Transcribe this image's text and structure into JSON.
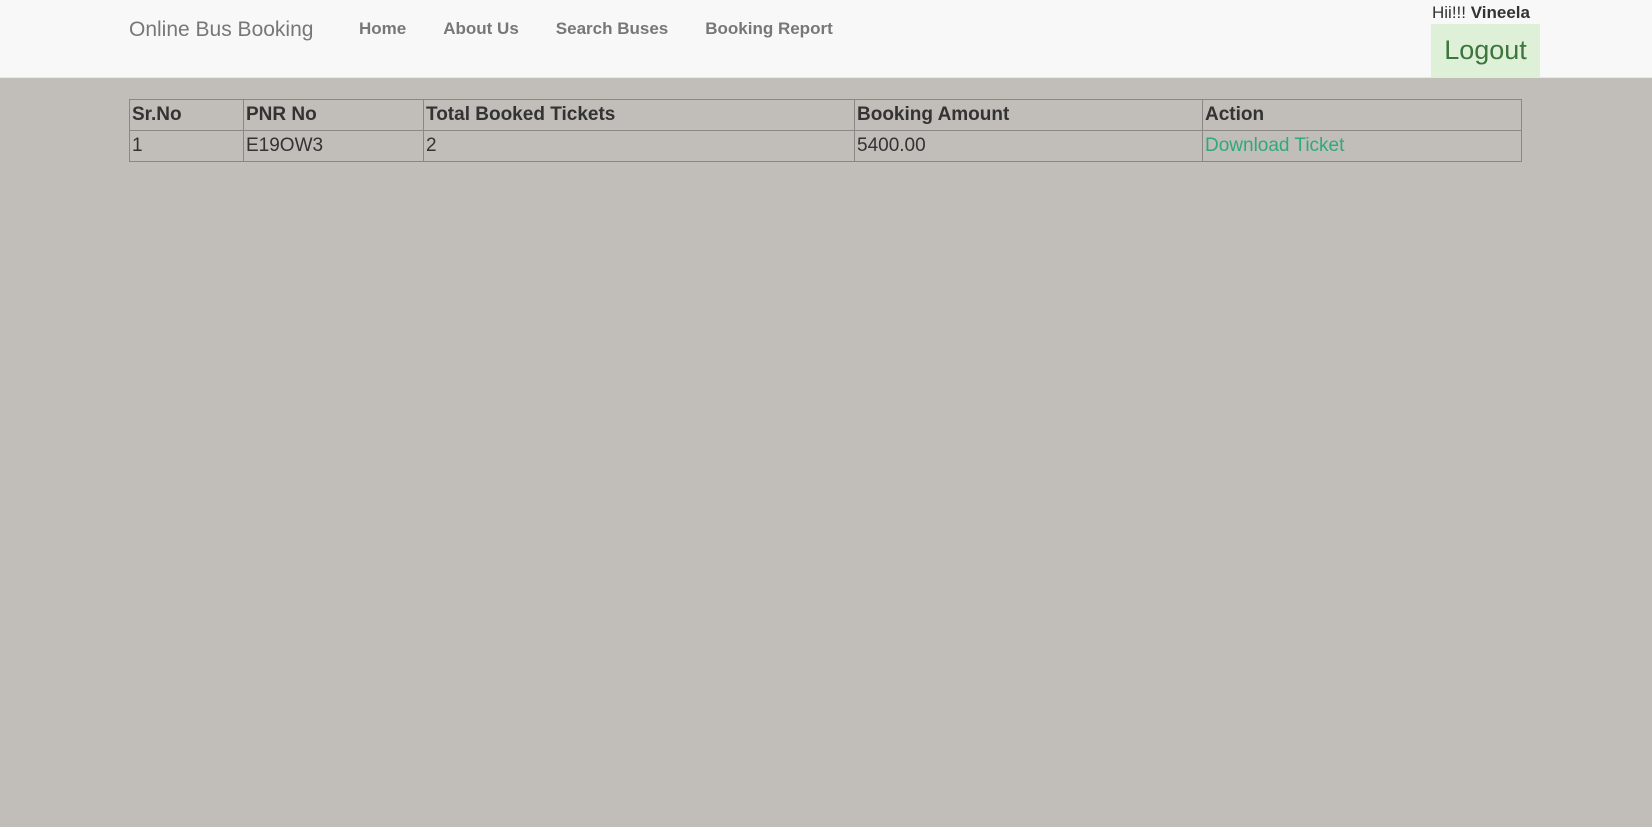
{
  "nav": {
    "brand": "Online Bus Booking",
    "links": [
      "Home",
      "About Us",
      "Search Buses",
      "Booking Report"
    ],
    "greeting": "Hii!!!",
    "username": "Vineela",
    "logout_label": "Logout"
  },
  "table": {
    "headers": [
      "Sr.No",
      "PNR No",
      "Total Booked Tickets",
      "Booking Amount",
      "Action"
    ],
    "rows": [
      {
        "sr": "1",
        "pnr": "E19OW3",
        "tickets": "2",
        "amount": "5400.00",
        "action": "Download Ticket"
      }
    ]
  },
  "colors": {
    "navbar": "#f8f8f8",
    "page_bg": "#c1bdb9",
    "link_action": "#2fa97c",
    "logout_bg": "#dff0d8",
    "logout_text": "#3c763d"
  }
}
